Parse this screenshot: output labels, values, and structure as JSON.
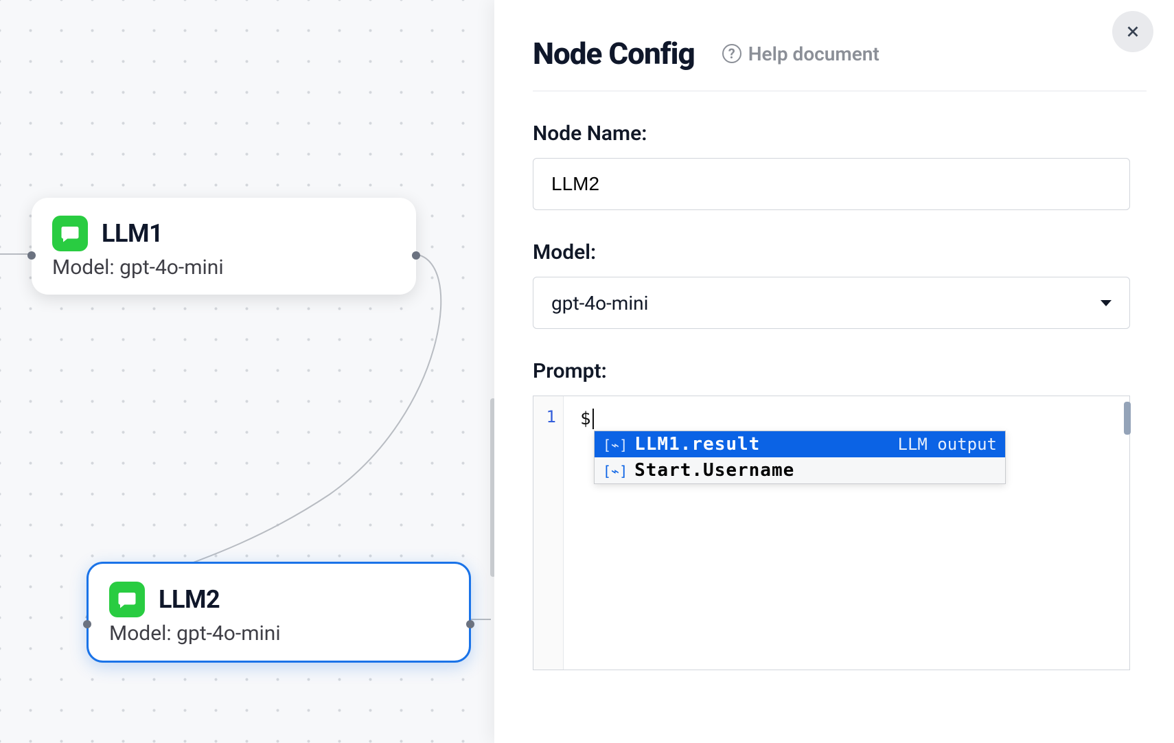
{
  "canvas": {
    "nodes": [
      {
        "id": "llm1",
        "title": "LLM1",
        "subtitle_prefix": "Model: ",
        "model": "gpt-4o-mini",
        "selected": false
      },
      {
        "id": "llm2",
        "title": "LLM2",
        "subtitle_prefix": "Model: ",
        "model": "gpt-4o-mini",
        "selected": true
      }
    ]
  },
  "panel": {
    "title": "Node Config",
    "help_text": "Help document",
    "fields": {
      "name_label": "Node Name:",
      "name_value": "LLM2",
      "model_label": "Model:",
      "model_value": "gpt-4o-mini",
      "prompt_label": "Prompt:",
      "prompt_line_number": "1",
      "prompt_text": "$"
    },
    "autocomplete": {
      "items": [
        {
          "label": "LLM1.result",
          "hint": "LLM output",
          "selected": true
        },
        {
          "label": "Start.Username",
          "hint": "",
          "selected": false
        }
      ]
    }
  }
}
